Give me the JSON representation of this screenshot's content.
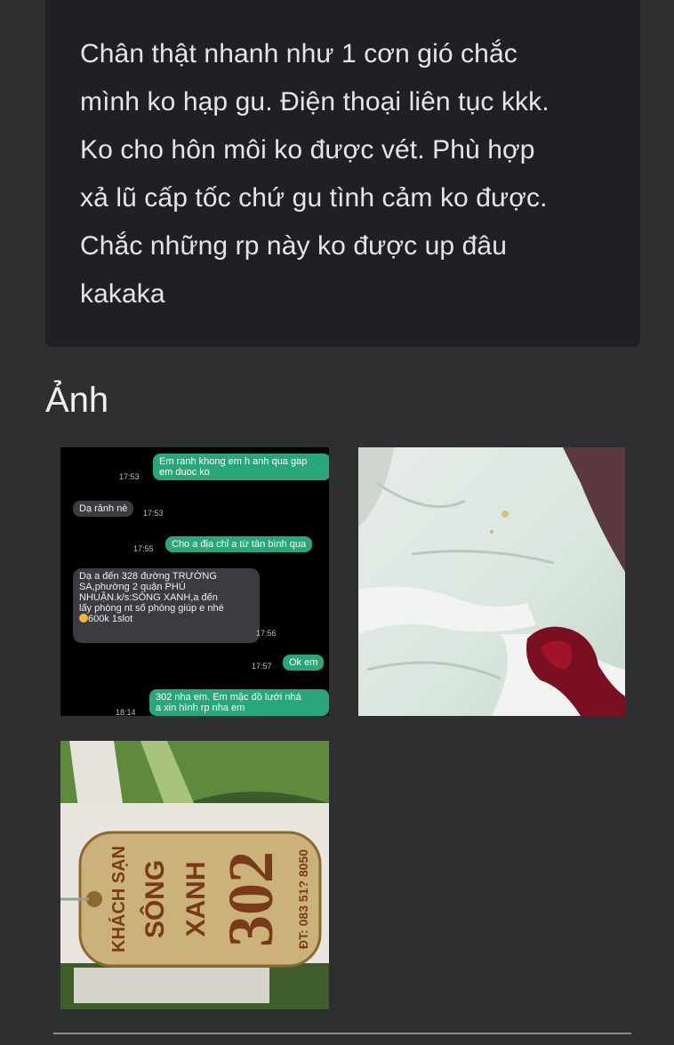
{
  "review": {
    "line1": "Chân thật nhanh như 1 cơn gió chắc",
    "line2": "mình ko hạp gu. Điện thoại liên tục kkk.",
    "line3": "Ko cho hôn môi ko được vét. Phù hợp",
    "line4": "xả lũ cấp tốc chứ gu tình cảm ko được.",
    "line5": "Chắc những rp này ko được up đâu",
    "line6": "kakaka"
  },
  "photos_section": {
    "title": "Ảnh"
  },
  "chat": {
    "m1_line1": "Em ranh khong em h anh qua gap",
    "m1_line2": "em duoc ko",
    "m1_time": "17:53",
    "m2_text": "Dạ rảnh nè",
    "m2_time": "17:53",
    "m3_text": "Cho a địa chỉ a từ tân bình qua",
    "m3_time": "17:55",
    "m4_line1": "Dạ a đến 328 đường TRƯỜNG",
    "m4_line2": "SA,phường 2 quận PHÚ",
    "m4_line3": "NHUẬN.k/s:SÔNG XANH,a đến",
    "m4_line4": "lấy phòng nt số phòng giúp e nhé",
    "m4_line5": "600k 1slot",
    "m4_time": "17:56",
    "m5_text": "Ok em",
    "m5_time": "17:57",
    "m6_line1": "302 nha em. Em mặc đồ lưới nhá",
    "m6_line2": "a xin hình rp nha em",
    "m6_time": "18:14"
  },
  "key_tag": {
    "line1": "KHÁCH SẠN",
    "line2": "SÔNG",
    "line3": "XANH",
    "room": "302",
    "phone": "ĐT: 083 51? 8050"
  },
  "colors": {
    "background": "#2e2f31",
    "card": "#1e2024",
    "outgoing_bubble": "#2aa77a",
    "incoming_bubble": "#3b3c40"
  }
}
